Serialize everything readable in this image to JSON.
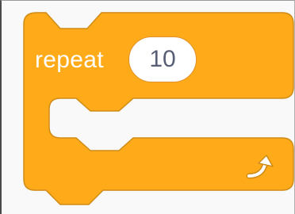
{
  "block": {
    "opcode_label": "repeat",
    "count_value": "10",
    "loop_icon": "loop-arrow-icon",
    "colors": {
      "fill": "#ffab19",
      "outline": "#cf8b17",
      "text": "#ffffff",
      "input_text": "#575e75",
      "input_bg": "#ffffff",
      "workspace": "#f9f9f9"
    }
  }
}
